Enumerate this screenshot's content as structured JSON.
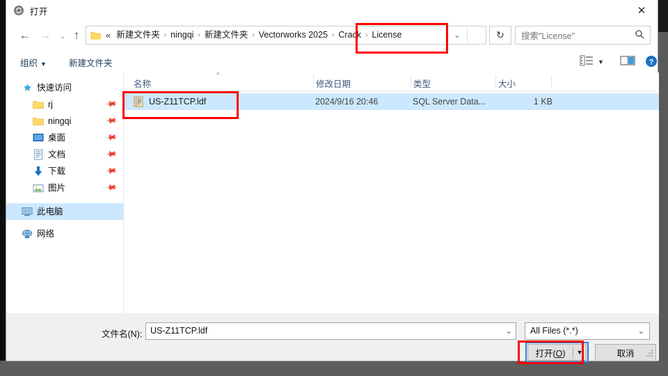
{
  "window": {
    "title": "打开",
    "title_icon": "refresh-circle-icon",
    "close_label": "✕"
  },
  "nav": {
    "back_icon": "←",
    "forward_icon": "→",
    "recent_icon": "⌄",
    "up_icon": "↑",
    "refresh_icon": "↻",
    "address_dropdown_icon": "⌄",
    "overflow_crumb": "«",
    "separator": "›",
    "breadcrumbs": [
      {
        "label": "新建文件夹",
        "highlighted": false
      },
      {
        "label": "ningqi",
        "highlighted": false
      },
      {
        "label": "新建文件夹",
        "highlighted": false
      },
      {
        "label": "Vectorworks 2025",
        "highlighted": false
      },
      {
        "label": "Crack",
        "highlighted": true
      },
      {
        "label": "License",
        "highlighted": true
      }
    ]
  },
  "search": {
    "placeholder": "搜索\"License\"",
    "icon": "search-icon"
  },
  "toolbar": {
    "organize_label": "组织",
    "organize_caret": "▼",
    "new_folder_label": "新建文件夹",
    "view_options_icon": "view-list-icon",
    "view_options_caret": "▼",
    "preview_pane_icon": "preview-pane-icon",
    "help_icon": "?"
  },
  "sidebar": {
    "items": [
      {
        "label": "快速访问",
        "icon": "star-pin-icon",
        "indent": 0,
        "pinned": false,
        "selected": false
      },
      {
        "label": "rj",
        "icon": "folder-icon",
        "indent": 1,
        "pinned": true,
        "selected": false
      },
      {
        "label": "ningqi",
        "icon": "folder-icon",
        "indent": 1,
        "pinned": true,
        "selected": false
      },
      {
        "label": "桌面",
        "icon": "desktop-icon",
        "indent": 1,
        "pinned": true,
        "selected": false
      },
      {
        "label": "文档",
        "icon": "document-icon",
        "indent": 1,
        "pinned": true,
        "selected": false
      },
      {
        "label": "下载",
        "icon": "download-icon",
        "indent": 1,
        "pinned": true,
        "selected": false
      },
      {
        "label": "图片",
        "icon": "pictures-icon",
        "indent": 1,
        "pinned": true,
        "selected": false
      },
      {
        "label": "此电脑",
        "icon": "this-pc-icon",
        "indent": 0,
        "pinned": false,
        "selected": true
      },
      {
        "label": "网络",
        "icon": "network-icon",
        "indent": 0,
        "pinned": false,
        "selected": false
      }
    ],
    "pin_glyph": "📌"
  },
  "filelist": {
    "columns": [
      {
        "label": "名称",
        "sorted": true,
        "sort_caret": "^"
      },
      {
        "label": "修改日期",
        "sorted": false
      },
      {
        "label": "类型",
        "sorted": false
      },
      {
        "label": "大小",
        "sorted": false
      }
    ],
    "rows": [
      {
        "name": "US-Z11TCP.ldf",
        "date": "2024/9/16 20:46",
        "type": "SQL Server Data...",
        "size": "1 KB",
        "icon": "sql-data-file-icon",
        "selected": true
      }
    ]
  },
  "footer": {
    "filename_label": "文件名(N):",
    "filename_value": "US-Z11TCP.ldf",
    "filename_caret": "⌄",
    "filetype_value": "All Files (*.*)",
    "filetype_caret": "⌄",
    "open_label_pre": "打开(",
    "open_label_key": "O",
    "open_label_post": ")",
    "open_caret": "▼",
    "cancel_label": "取消"
  },
  "colors": {
    "selection": "#cce8ff",
    "annotation": "#ff0000",
    "focus_ring": "#2a7fd4",
    "link_text": "#1c3b5a",
    "folder_yellow": "#ffd96b"
  }
}
